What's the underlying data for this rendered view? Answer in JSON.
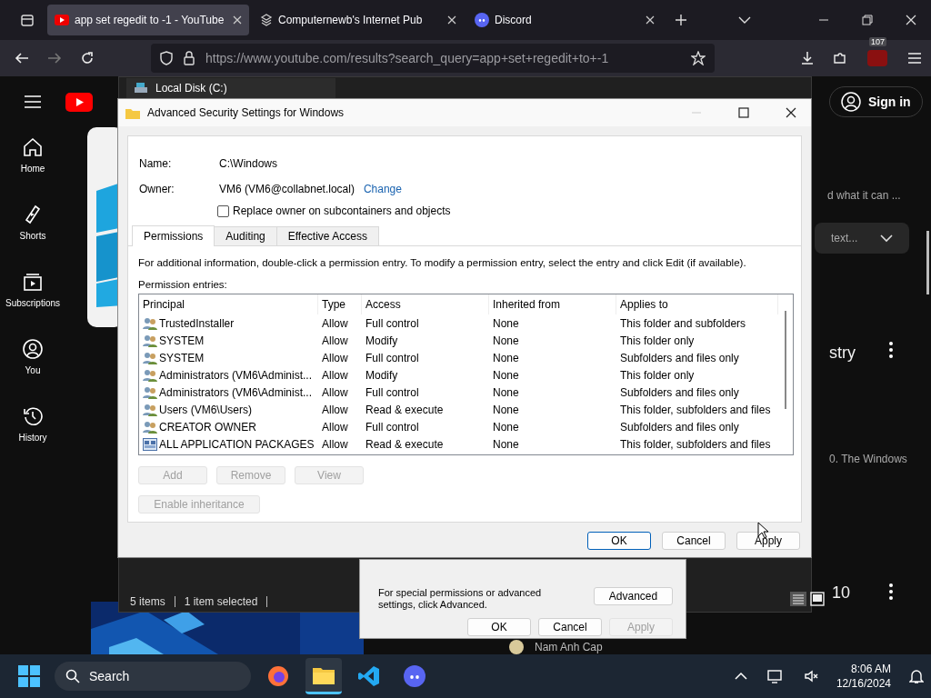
{
  "browser": {
    "tabs": [
      {
        "title": "app set regedit to -1 - YouTube",
        "selected": true,
        "kind": "youtube"
      },
      {
        "title": "Computernewb's Internet Pub",
        "selected": false,
        "kind": "pub"
      },
      {
        "title": "Discord",
        "selected": false,
        "kind": "discord"
      }
    ],
    "url": "https://www.youtube.com/results?search_query=app+set+regedit+to+-1",
    "extension_badge": "107"
  },
  "youtube": {
    "sidebar": [
      {
        "label": "Home",
        "kind": "home"
      },
      {
        "label": "Shorts",
        "kind": "shorts"
      },
      {
        "label": "Subscriptions",
        "kind": "subscriptions"
      },
      {
        "label": "You",
        "kind": "you"
      },
      {
        "label": "History",
        "kind": "history"
      }
    ],
    "sign_in": "Sign in",
    "description_1": "d what it can ...",
    "transcript_dropdown": "text...",
    "title_2": "stry",
    "description_2": "0. The Windows",
    "title_3": "10",
    "channel": "Nam Anh Cap"
  },
  "explorer": {
    "tab": "Local Disk (C:)",
    "status": [
      "5 items",
      "1 item selected"
    ]
  },
  "properties": {
    "hint": "For special permissions or advanced settings, click Advanced.",
    "advanced_button": "Advanced",
    "buttons": [
      {
        "label": "OK",
        "disabled": false
      },
      {
        "label": "Cancel",
        "disabled": false
      },
      {
        "label": "Apply",
        "disabled": true
      }
    ]
  },
  "dialog": {
    "title": "Advanced Security Settings for Windows",
    "name_label": "Name:",
    "name": "C:\\Windows",
    "owner_label": "Owner:",
    "owner": "VM6 (VM6@collabnet.local)",
    "change_link": "Change",
    "replace_owner": {
      "label": "Replace owner on subcontainers and objects",
      "checked": false
    },
    "tabs": [
      {
        "label": "Permissions",
        "selected": true
      },
      {
        "label": "Auditing",
        "selected": false
      },
      {
        "label": "Effective Access",
        "selected": false
      }
    ],
    "info": "For additional information, double-click a permission entry. To modify a permission entry, select the entry and click Edit (if available).",
    "entries_label": "Permission entries:",
    "columns": [
      "Principal",
      "Type",
      "Access",
      "Inherited from",
      "Applies to"
    ],
    "rows": [
      {
        "kind": "group",
        "principal": "TrustedInstaller",
        "type": "Allow",
        "access": "Full control",
        "inherited": "None",
        "applies": "This folder and subfolders"
      },
      {
        "kind": "group",
        "principal": "SYSTEM",
        "type": "Allow",
        "access": "Modify",
        "inherited": "None",
        "applies": "This folder only"
      },
      {
        "kind": "group",
        "principal": "SYSTEM",
        "type": "Allow",
        "access": "Full control",
        "inherited": "None",
        "applies": "Subfolders and files only"
      },
      {
        "kind": "group",
        "principal": "Administrators (VM6\\Administ...",
        "type": "Allow",
        "access": "Modify",
        "inherited": "None",
        "applies": "This folder only"
      },
      {
        "kind": "group",
        "principal": "Administrators (VM6\\Administ...",
        "type": "Allow",
        "access": "Full control",
        "inherited": "None",
        "applies": "Subfolders and files only"
      },
      {
        "kind": "group",
        "principal": "Users (VM6\\Users)",
        "type": "Allow",
        "access": "Read & execute",
        "inherited": "None",
        "applies": "This folder, subfolders and files"
      },
      {
        "kind": "group",
        "principal": "CREATOR OWNER",
        "type": "Allow",
        "access": "Full control",
        "inherited": "None",
        "applies": "Subfolders and files only"
      },
      {
        "kind": "package",
        "principal": "ALL APPLICATION PACKAGES",
        "type": "Allow",
        "access": "Read & execute",
        "inherited": "None",
        "applies": "This folder, subfolders and files"
      }
    ],
    "entry_buttons": [
      {
        "label": "Add",
        "disabled": true
      },
      {
        "label": "Remove",
        "disabled": true
      },
      {
        "label": "View",
        "disabled": true
      }
    ],
    "inheritance_button": {
      "label": "Enable inheritance",
      "disabled": true
    },
    "footer_buttons": [
      {
        "label": "OK",
        "disabled": false,
        "default": true
      },
      {
        "label": "Cancel",
        "disabled": false,
        "default": false
      },
      {
        "label": "Apply",
        "disabled": false,
        "default": false
      }
    ]
  },
  "taskbar": {
    "search": "Search",
    "apps": [
      {
        "kind": "firefox",
        "active": false
      },
      {
        "kind": "explorer",
        "active": true
      },
      {
        "kind": "vscode",
        "active": false
      },
      {
        "kind": "discord",
        "active": false
      }
    ],
    "time": "8:06 AM",
    "date": "12/16/2024"
  }
}
